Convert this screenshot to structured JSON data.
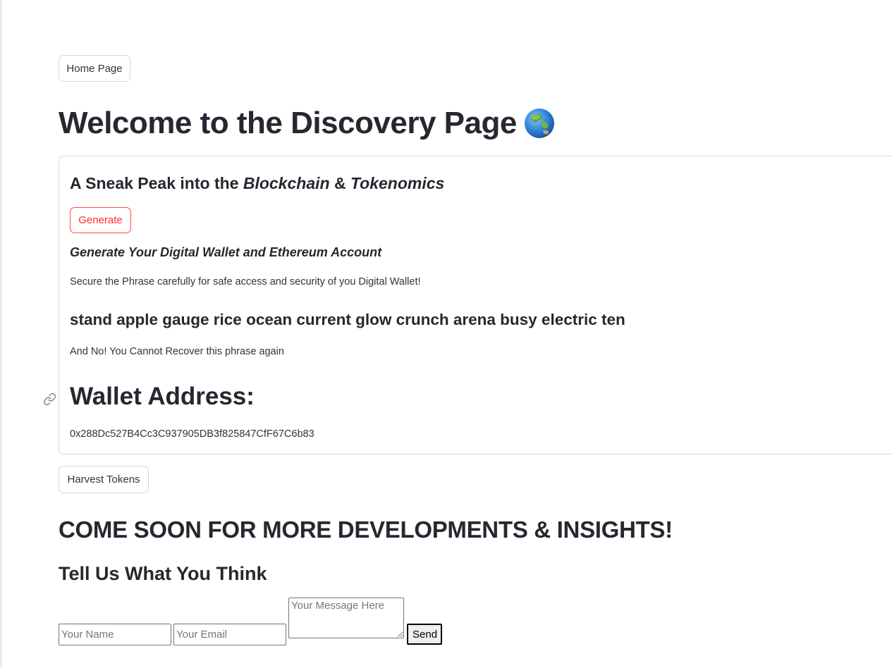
{
  "nav": {
    "home_label": "Home Page"
  },
  "header": {
    "title": "Welcome to the Discovery Page"
  },
  "card": {
    "heading_prefix": "A Sneak Peak into the ",
    "heading_term1": "Blockchain",
    "heading_amp": " & ",
    "heading_term2": "Tokenomics",
    "generate_label": "Generate",
    "subtitle": "Generate Your Digital Wallet and Ethereum Account",
    "secure_note": "Secure the Phrase carefully for safe access and security of you Digital Wallet!",
    "phrase": "stand apple gauge rice ocean current glow crunch arena busy electric ten",
    "recover_note": "And No! You Cannot Recover this phrase again",
    "wallet_heading": "Wallet Address:",
    "wallet_address": "0x288Dc527B4Cc3C937905DB3f825847CfF67C6b83"
  },
  "actions": {
    "harvest_label": "Harvest Tokens"
  },
  "announcement": "COME SOON FOR MORE DEVELOPMENTS & INSIGHTS!",
  "feedback": {
    "heading": "Tell Us What You Think",
    "name_placeholder": "Your Name",
    "email_placeholder": "Your Email",
    "message_placeholder": "Your Message Here",
    "send_label": "Send"
  },
  "colors": {
    "accent": "#ff4b4b",
    "text": "#262730",
    "border": "#d6d6d9"
  },
  "icons": {
    "title_emoji": "globe-asia-australia-icon",
    "anchor": "link-icon"
  }
}
